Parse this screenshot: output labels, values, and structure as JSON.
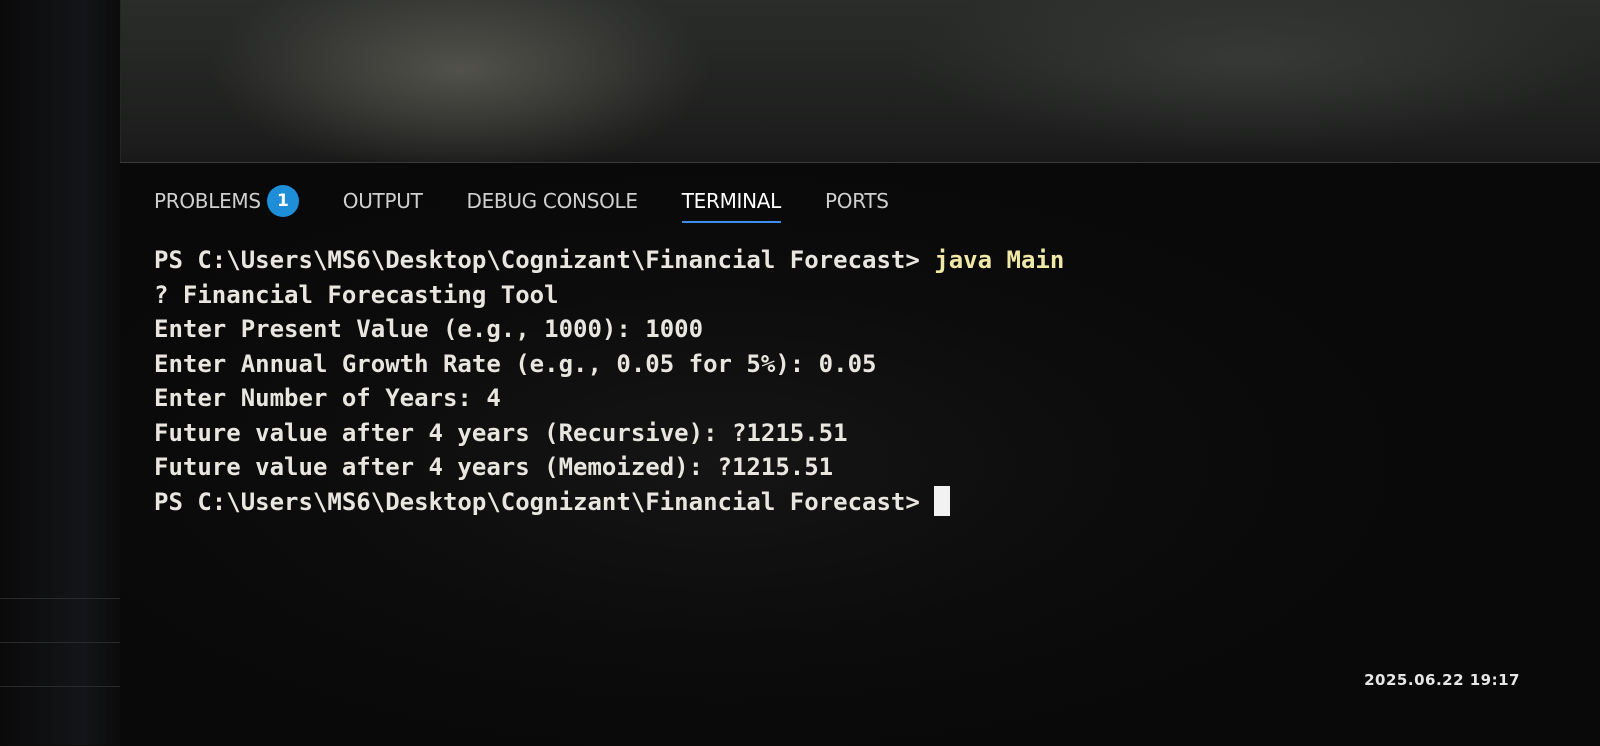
{
  "panel": {
    "tabs": [
      {
        "label": "PROBLEMS",
        "badge": "1",
        "active": false
      },
      {
        "label": "OUTPUT",
        "active": false
      },
      {
        "label": "DEBUG CONSOLE",
        "active": false
      },
      {
        "label": "TERMINAL",
        "active": true
      },
      {
        "label": "PORTS",
        "active": false
      }
    ]
  },
  "terminal": {
    "prompt": "PS C:\\Users\\MS6\\Desktop\\Cognizant\\Financial Forecast>",
    "command": "java Main",
    "output": [
      "? Financial Forecasting Tool",
      "Enter Present Value (e.g., 1000): 1000",
      "Enter Annual Growth Rate (e.g., 0.05 for 5%): 0.05",
      "Enter Number of Years: 4",
      "Future value after 4 years (Recursive): ?1215.51",
      "Future value after 4 years (Memoized): ?1215.51"
    ],
    "final_prompt": "PS C:\\Users\\MS6\\Desktop\\Cognizant\\Financial Forecast>"
  },
  "photo": {
    "timestamp": "2025.06.22 19:17"
  },
  "colors": {
    "badge": "#1e8ed8",
    "active_tab_underline": "#3b8eea",
    "command": "#efe8a6",
    "terminal_text": "#e8e6df"
  }
}
